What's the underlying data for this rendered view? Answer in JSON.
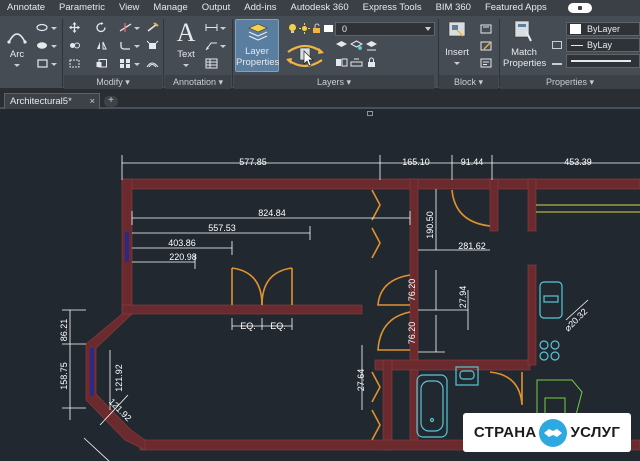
{
  "menubar": {
    "tabs": [
      "Annotate",
      "Parametric",
      "View",
      "Manage",
      "Output",
      "Add-ins",
      "Autodesk 360",
      "Express Tools",
      "BIM 360",
      "Featured Apps"
    ]
  },
  "ribbon": {
    "panels": {
      "modify": "Modify",
      "annotation": "Annotation",
      "layers": "Layers",
      "block": "Block",
      "properties": "Properties"
    },
    "buttons": {
      "arc": "Arc",
      "text": "Text",
      "layer_properties_line1": "Layer",
      "layer_properties_line2": "Properties",
      "insert": "Insert",
      "match_properties_line1": "Match",
      "match_properties_line2": "Properties"
    },
    "layer_dropdown": "0",
    "property_dropdowns": [
      "ByLayer",
      "ByLay"
    ]
  },
  "file_tabs": {
    "active": "Architectural5*",
    "close_glyph": "×",
    "add_glyph": "+"
  },
  "drawing": {
    "dimensions": {
      "d_577": "577.85",
      "d_165": "165.10",
      "d_91": "91.44",
      "d_453": "453.39",
      "d_824": "824.84",
      "d_557": "557.53",
      "d_403": "403.86",
      "d_220": "220.98",
      "d_190": "190.50",
      "d_281": "281.62",
      "d_76a": "76.20",
      "d_27a": "27.94",
      "d_76b": "76.20",
      "d_86": "86.21",
      "d_158": "158.75",
      "d_121a": "121.92",
      "d_121b": "121.92",
      "d_27b": "27.64",
      "d_20": "⌀20.32",
      "eq1": "EQ.",
      "eq2": "EQ."
    }
  },
  "watermark": {
    "left": "СТРАНА",
    "right": "УСЛУГ"
  },
  "colors": {
    "canvas": "#212830",
    "wall": "#6b2a2d",
    "door": "#e0922e",
    "fixture": "#58c7d6",
    "dimension": "#ffffff",
    "window": "#2a2a8a"
  }
}
